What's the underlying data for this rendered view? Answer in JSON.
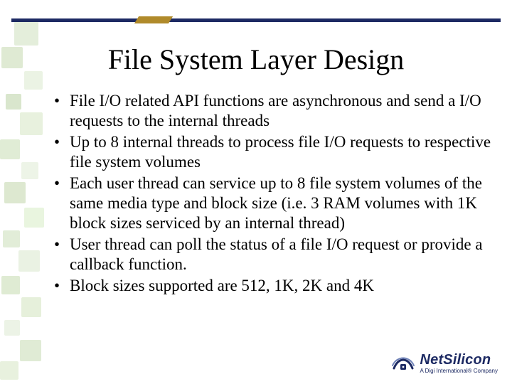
{
  "title": "File System Layer Design",
  "bullets": [
    "File I/O related API functions are asynchronous and send a I/O requests to the internal threads",
    "Up to 8 internal threads to process file I/O requests to respective file system volumes",
    "Each user thread can service up to 8 file system volumes of the same media type and block size (i.e. 3 RAM volumes with 1K block sizes serviced by an internal thread)",
    "User thread can poll the status of a file I/O request or provide a callback function.",
    "Block sizes supported are 512, 1K, 2K and 4K"
  ],
  "footer": {
    "brand": "NetSilicon",
    "tagline": "A Digi International® Company"
  },
  "colors": {
    "rule_navy": "#1d2a63",
    "rule_gold": "#b08a2a",
    "deco_green": "#d7e6c9"
  }
}
